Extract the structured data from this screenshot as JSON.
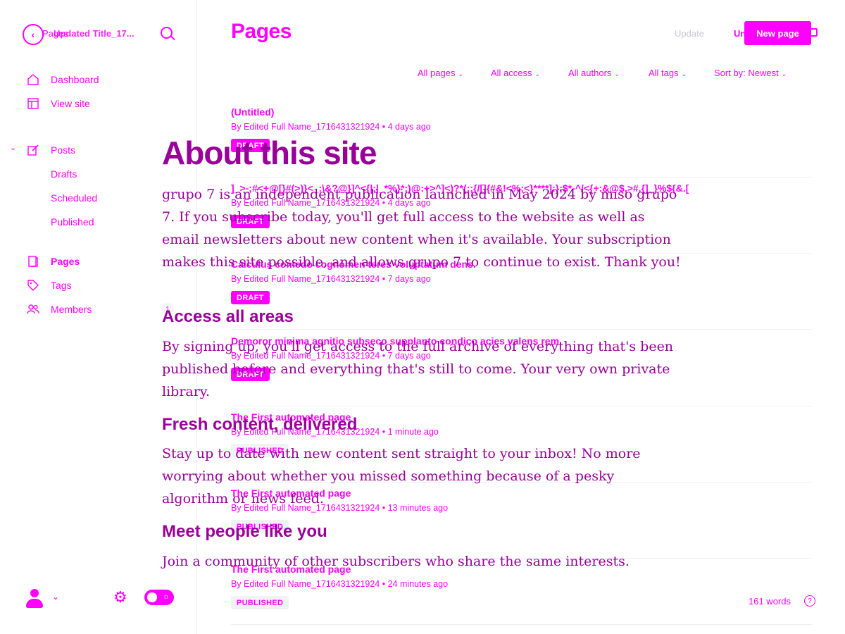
{
  "sidebar": {
    "back_icon": "chevron-left-icon",
    "crumb_section": "Pages",
    "crumb_title": "Updated Title_17...",
    "nav": [
      {
        "label": "Dashboard",
        "icon": "house-icon"
      },
      {
        "label": "View site",
        "icon": "layout-icon"
      },
      {
        "label": "Posts",
        "icon": "pencil-icon"
      },
      {
        "label": "Drafts"
      },
      {
        "label": "Scheduled"
      },
      {
        "label": "Published"
      },
      {
        "label": "Pages",
        "icon": "page-icon"
      },
      {
        "label": "Tags",
        "icon": "tag-icon"
      },
      {
        "label": "Members",
        "icon": "members-icon"
      }
    ]
  },
  "header": {
    "title": "Pages",
    "update": "Update",
    "unpublish": "Unpublish",
    "new_page": "New page"
  },
  "filters": [
    "All pages",
    "All access",
    "All authors",
    "All tags",
    "Sort by: Newest"
  ],
  "pages": [
    {
      "title": "(Untitled)",
      "meta": "By Edited Full Name_1716431321924 • 4 days ago",
      "status": "DRAFT"
    },
    {
      "title": "]_>-;#<+@[}#(>)}<_:\\&?@}]^<{|;|_*%}*;)@:+>^]<)?*(;;{/[]{#&!<%;<}****]:};$*-^/<{+:&@$,>#.{]_}%${&.[",
      "meta": "By Edited Full Name_1716431321924 • 4 days ago",
      "status": "DRAFT"
    },
    {
      "title": "Calculus comedo cognomen teres voluptatum dens.",
      "meta": "By Edited Full Name_1716431321924 • 7 days ago",
      "status": "DRAFT"
    },
    {
      "title": "Demoror minima agnitio subseco supplanto condico acies valens rem.",
      "meta": "By Edited Full Name_1716431321924 • 7 days ago",
      "status": "DRAFT"
    },
    {
      "title": "The First automated page",
      "meta": "By Edited Full Name_1716431321924 • 1 minute ago",
      "status": "PUBLISHED"
    },
    {
      "title": "The First automated page",
      "meta": "By Edited Full Name_1716431321924 • 13 minutes ago",
      "status": "PUBLISHED"
    },
    {
      "title": "The First automated page",
      "meta": "By Edited Full Name_1716431321924 • 24 minutes ago",
      "status": "PUBLISHED"
    }
  ],
  "overlay": {
    "heading": "About this site",
    "intro": "grupo 7 is an independent publication launched in May 2024 by miso grupo 7. If you subscribe today, you'll get full access to the website as well as email newsletters about new content when it's available. Your subscription makes this site possible, and allows grupo 7 to continue to exist. Thank you!",
    "sections": [
      {
        "heading": "Access all areas",
        "body": "By signing up, you'll get access to the full archive of everything that's been published before and everything that's still to come. Your very own private library."
      },
      {
        "heading": "Fresh content, delivered",
        "body": "Stay up to date with new content sent straight to your inbox! No more worrying about whether you missed something because of a pesky algorithm or news feed."
      },
      {
        "heading": "Meet people like you",
        "body": "Join a community of other subscribers who share the same interests."
      }
    ],
    "marker": "1"
  },
  "footer": {
    "word_count": "161 words",
    "help": "?"
  },
  "colors": {
    "accent": "#ff00ff",
    "overlay_text": "#990099",
    "divider": "#eef0f2"
  }
}
